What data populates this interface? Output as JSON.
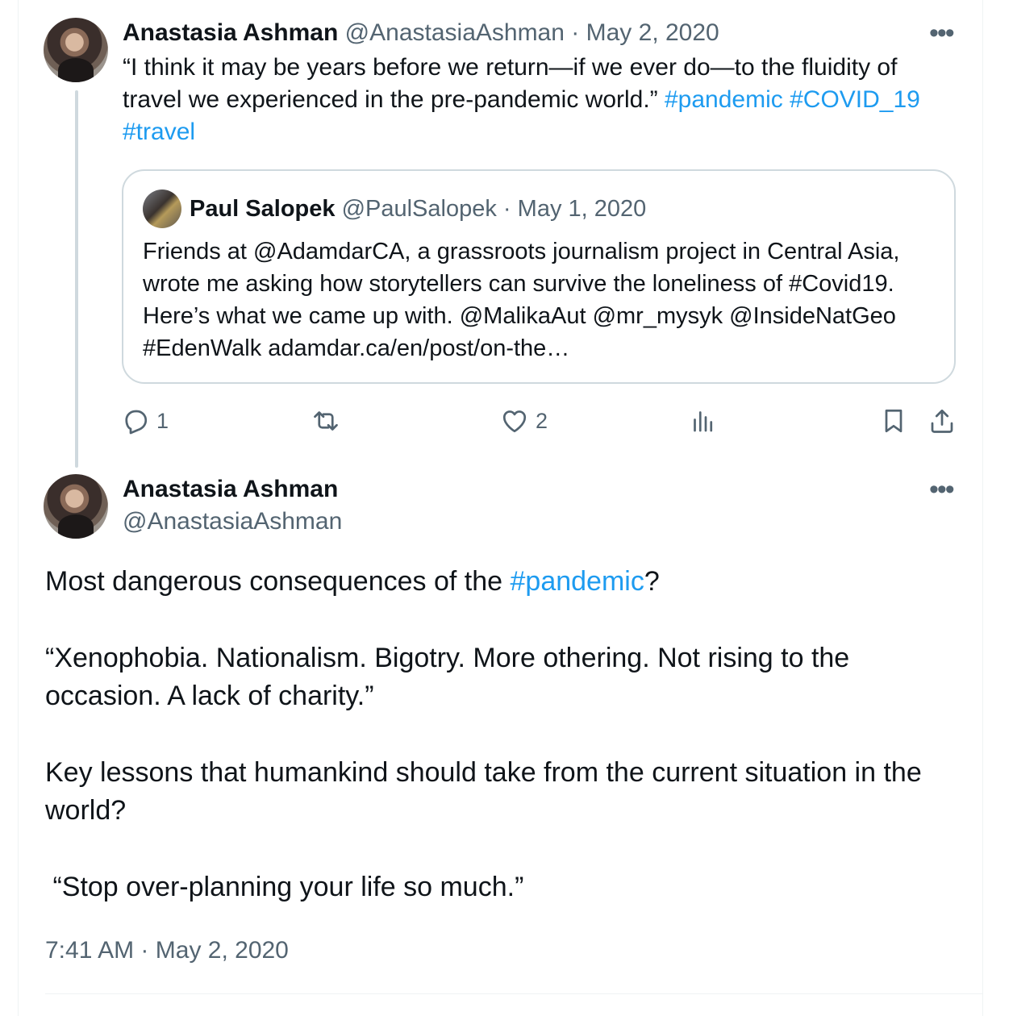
{
  "tweet1": {
    "author_name": "Anastasia Ashman",
    "author_handle": "@AnastasiaAshman",
    "separator": "·",
    "date": "May 2, 2020",
    "text_plain": "“I think it may be years before we return—if we ever do—to the fluidity of travel we experienced in the pre-pandemic world.” ",
    "hashtags": [
      "#pandemic",
      "#COVID_19",
      "#travel"
    ],
    "quote": {
      "author_name": "Paul Salopek",
      "author_handle": "@PaulSalopek",
      "separator": "·",
      "date": "May 1, 2020",
      "text": "Friends at @AdamdarCA, a grassroots journalism project in Central Asia, wrote me asking how storytellers can survive the loneliness of #Covid19. Here’s what we came up with. @MalikaAut @mr_mysyk @InsideNatGeo #EdenWalk adamdar.ca/en/post/on-the…"
    },
    "actions": {
      "reply_count": "1",
      "retweet_count": "",
      "like_count": "2"
    }
  },
  "tweet2": {
    "author_name": "Anastasia Ashman",
    "author_handle": "@AnastasiaAshman",
    "p1_before": "Most dangerous consequences of the ",
    "p1_hashtag": "#pandemic",
    "p1_after": "?",
    "p2": "“Xenophobia. Nationalism. Bigotry. More othering. Not rising to the occasion. A lack of charity.”",
    "p3": "Key lessons that humankind should take from the current situation in the world?",
    "p4": " “Stop over-planning your life so much.”",
    "time": "7:41 AM",
    "separator": "·",
    "date": "May 2, 2020"
  },
  "colors": {
    "text": "#0f1419",
    "muted": "#536471",
    "link": "#1d9bf0",
    "border": "#cfd9de"
  },
  "icons": [
    "more-icon",
    "reply-icon",
    "retweet-icon",
    "like-icon",
    "views-icon",
    "bookmark-icon",
    "share-icon"
  ]
}
